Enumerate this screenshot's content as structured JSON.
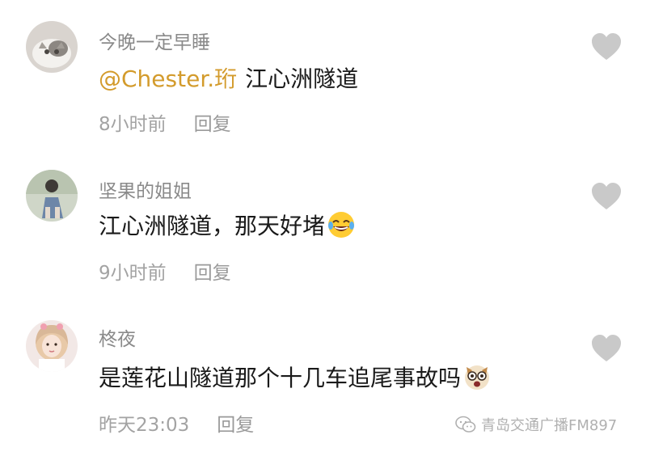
{
  "comments": [
    {
      "username": "今晚一定早睡",
      "mention": "@Chester.珩",
      "text": "江心洲隧道",
      "time": "8小时前",
      "reply_label": "回复",
      "avatar_icon": "cat-avatar"
    },
    {
      "username": "坚果的姐姐",
      "mention": "",
      "text": "江心洲隧道，那天好堵",
      "emoji": "laughing-crying-emoji",
      "time": "9小时前",
      "reply_label": "回复",
      "avatar_icon": "person-outdoor-avatar"
    },
    {
      "username": "柊夜",
      "mention": "",
      "text": "是莲花山隧道那个十几车追尾事故吗",
      "emoji": "shocked-dog-emoji",
      "time": "昨天23:03",
      "reply_label": "回复",
      "avatar_icon": "girl-portrait-avatar"
    }
  ],
  "like_icon": "heart-icon",
  "watermark": {
    "text": "青岛交通广播FM897",
    "icon": "wechat-icon"
  },
  "colors": {
    "mention": "#d39b2c",
    "username": "#8a8a8a",
    "meta": "#a3a3a3",
    "heart": "#c9c9c9"
  }
}
